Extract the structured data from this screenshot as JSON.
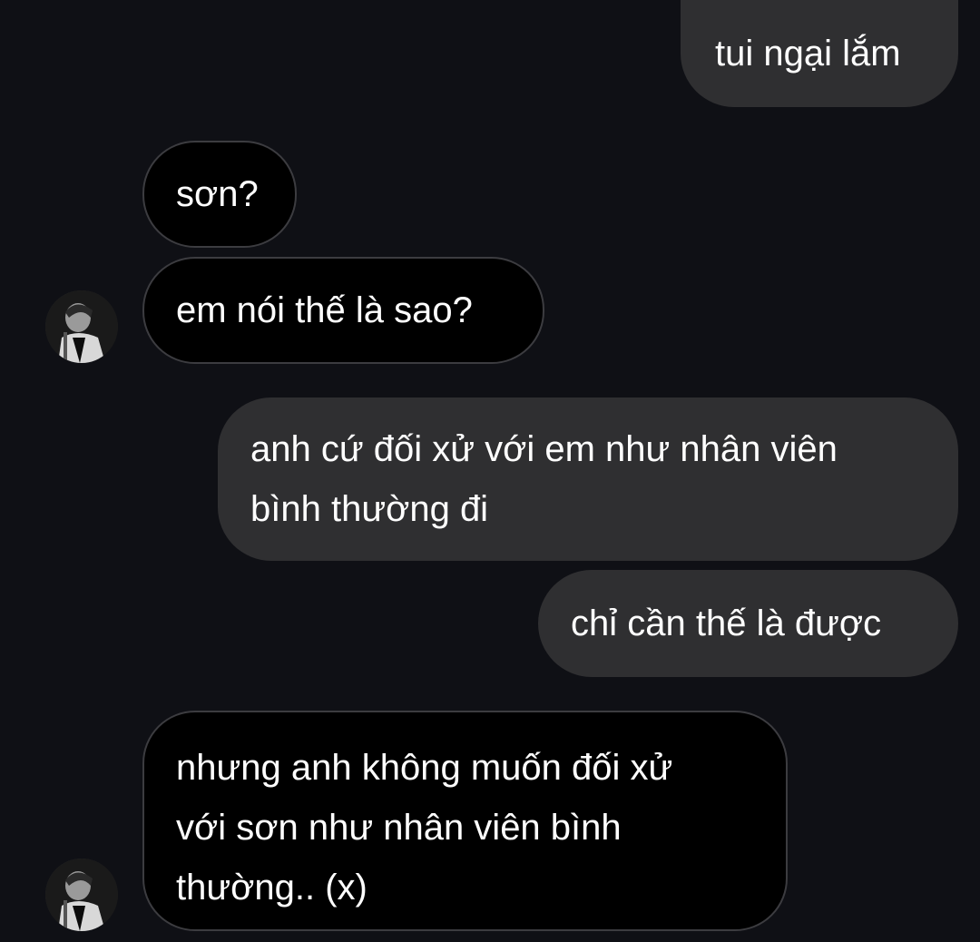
{
  "messages": [
    {
      "direction": "outgoing",
      "lines": [
        "tui ngại lắm"
      ]
    },
    {
      "direction": "incoming",
      "lines": [
        "sơn?"
      ]
    },
    {
      "direction": "incoming",
      "lines": [
        "em nói thế là sao?"
      ],
      "avatar": "contact-avatar"
    },
    {
      "direction": "outgoing",
      "lines": [
        "anh cứ đối xử với em như nhân viên",
        "bình thường đi"
      ]
    },
    {
      "direction": "outgoing",
      "lines": [
        "chỉ cần thế là được"
      ]
    },
    {
      "direction": "incoming",
      "lines": [
        "nhưng anh không muốn đối xử",
        "với sơn như nhân viên bình",
        "thường.. (x)"
      ],
      "avatar": "contact-avatar"
    }
  ],
  "colors": {
    "background": "#0f1015",
    "outgoing_bubble": "#2f2f31",
    "incoming_bubble": "#000000",
    "incoming_border": "#3c3c40",
    "text": "#ffffff"
  }
}
